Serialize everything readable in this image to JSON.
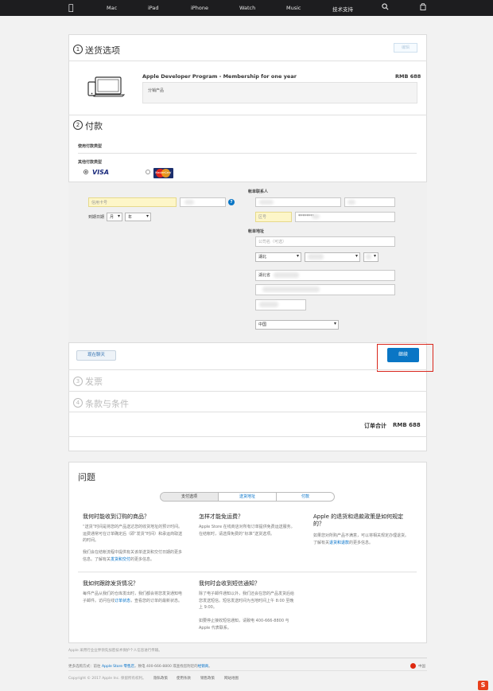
{
  "nav": {
    "items": [
      "Mac",
      "iPad",
      "iPhone",
      "Watch",
      "Music",
      "技术支持"
    ]
  },
  "shipping": {
    "step": "1",
    "title": "送货选项",
    "edit_label": "编辑",
    "product_name": "Apple Developer Program - Membership for one year",
    "price": "RMB 688",
    "product_note": "分销产品"
  },
  "payment": {
    "step": "2",
    "title": "付款",
    "used_label": "使用付款类型",
    "other_label": "其他付款类型",
    "visa": "VISA",
    "mastercard": "MasterCard",
    "card_number_placeholder": "信用卡号",
    "expiry_label": "到期日期",
    "month": "月",
    "year": "年",
    "help": "?",
    "billing_contact_label": "帐单联系人",
    "billing_address_label": "帐单地址",
    "phone_placeholder": "区号",
    "phone_value": "********",
    "company_placeholder": "公司名（可选）",
    "province": "湖北",
    "address_prefix": "湖北省",
    "country": "中国",
    "back_label": "现在聊天",
    "continue_label": "继续"
  },
  "invoice": {
    "step": "3",
    "title": "发票"
  },
  "terms": {
    "step": "4",
    "title": "条款与条件"
  },
  "total": {
    "label": "订单合计",
    "value": "RMB 688"
  },
  "faq": {
    "title": "问题",
    "tabs": [
      "支付选项",
      "送货地址",
      "付款"
    ],
    "items": [
      {
        "q": "我何时能收到订购的商品？",
        "a1": "“送货”时间是将您的产品送达您的收货地址的预计时间。运费通常可在订单确定后（即“发货”时间）和承运商取送的时间。",
        "a2": "我们会在结帐流程中提供有关该单送货和交付日期的更多信息。了解有关",
        "a2link": "发货和交付",
        "a2end": "的更多信息。"
      },
      {
        "q": "怎样才能免运费？",
        "a1": "Apple Store 在线商店对所有订单提供免费运送服务。在结帐时，请选择免费的“标准”送货选项。"
      },
      {
        "q": "Apple 的退货和退款政策是如何规定的？",
        "a1": "如果您对所购产品不满意，可以将相关规定办理退货。了解有关",
        "a1link": "退货和退款",
        "a1end": "的更多信息。"
      },
      {
        "q": "我如何跟踪发货情况？",
        "a1": "每件产品从我们的仓库发出时，我们都会将您发货通知电子邮件。访问在线",
        "a1link": "订单状态",
        "a1end": "，查看您的订单的最新状态。"
      },
      {
        "q": "我何时会收到短信通知？",
        "a1": "除了电子邮件通知以外，我们还会在您的产品发货后给您发送短信。短信发送时间为当地时间上午 8:00 至晚上 9:00。",
        "a2": "如要停止接收短信通知，请致电 400-666-8800 与 Apple 代表联系。"
      }
    ]
  },
  "footer": {
    "note": "Apple 采用行业业界领先加密技术保护个人信息进行传输。",
    "more_ways": "更多选购方式：前往 ",
    "store_link": "Apple Store 零售店",
    "call": "，致电 400-666-8800 或查找您附近的",
    "reseller_link": "经销商",
    "period": "。",
    "region": "中国",
    "copyright": "Copyright © 2017 Apple Inc. 保留所有权利。",
    "links": [
      "隐私政策",
      "使用条款",
      "销售政策",
      "网站地图"
    ]
  }
}
